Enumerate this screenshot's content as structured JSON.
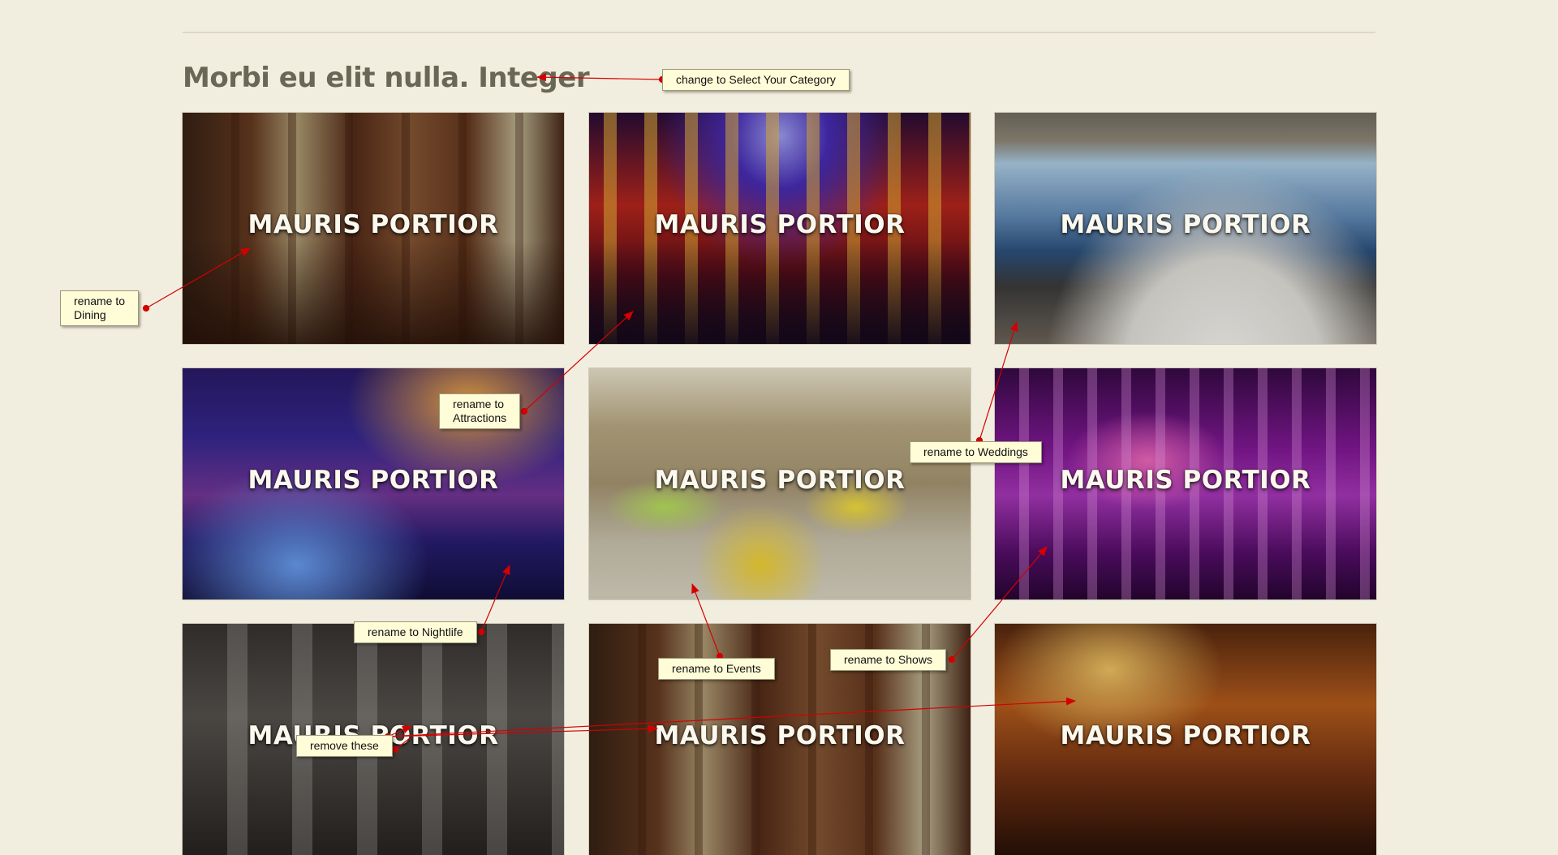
{
  "page": {
    "title": "Morbi eu elit nulla. Integer"
  },
  "tiles": [
    {
      "label": "MAURIS PORTIOR",
      "scene": "dining-room"
    },
    {
      "label": "MAURIS PORTIOR",
      "scene": "nightclub-crowd"
    },
    {
      "label": "MAURIS PORTIOR",
      "scene": "ocean-view-restaurant"
    },
    {
      "label": "MAURIS PORTIOR",
      "scene": "concert-stage"
    },
    {
      "label": "MAURIS PORTIOR",
      "scene": "banquet-hall"
    },
    {
      "label": "MAURIS PORTIOR",
      "scene": "purple-ballroom"
    },
    {
      "label": "MAURIS PORTIOR",
      "scene": "dark-restaurant"
    },
    {
      "label": "MAURIS PORTIOR",
      "scene": "wood-dining-room"
    },
    {
      "label": "MAURIS PORTIOR",
      "scene": "lounge-bar"
    }
  ],
  "annotations": {
    "title_note": "change to Select Your Category",
    "dining_note_line1": "rename to",
    "dining_note_line2": "Dining",
    "attractions_note_line1": "rename to",
    "attractions_note_line2": "Attractions",
    "weddings_note": "rename to Weddings",
    "nightlife_note": "rename to Nightlife",
    "events_note": "rename to Events",
    "shows_note": "rename to Shows",
    "remove_note": "remove these"
  },
  "colors": {
    "background": "#f2eedf",
    "title": "#6b6756",
    "note_fill": "#fffdd8",
    "arrow": "#d40000"
  }
}
